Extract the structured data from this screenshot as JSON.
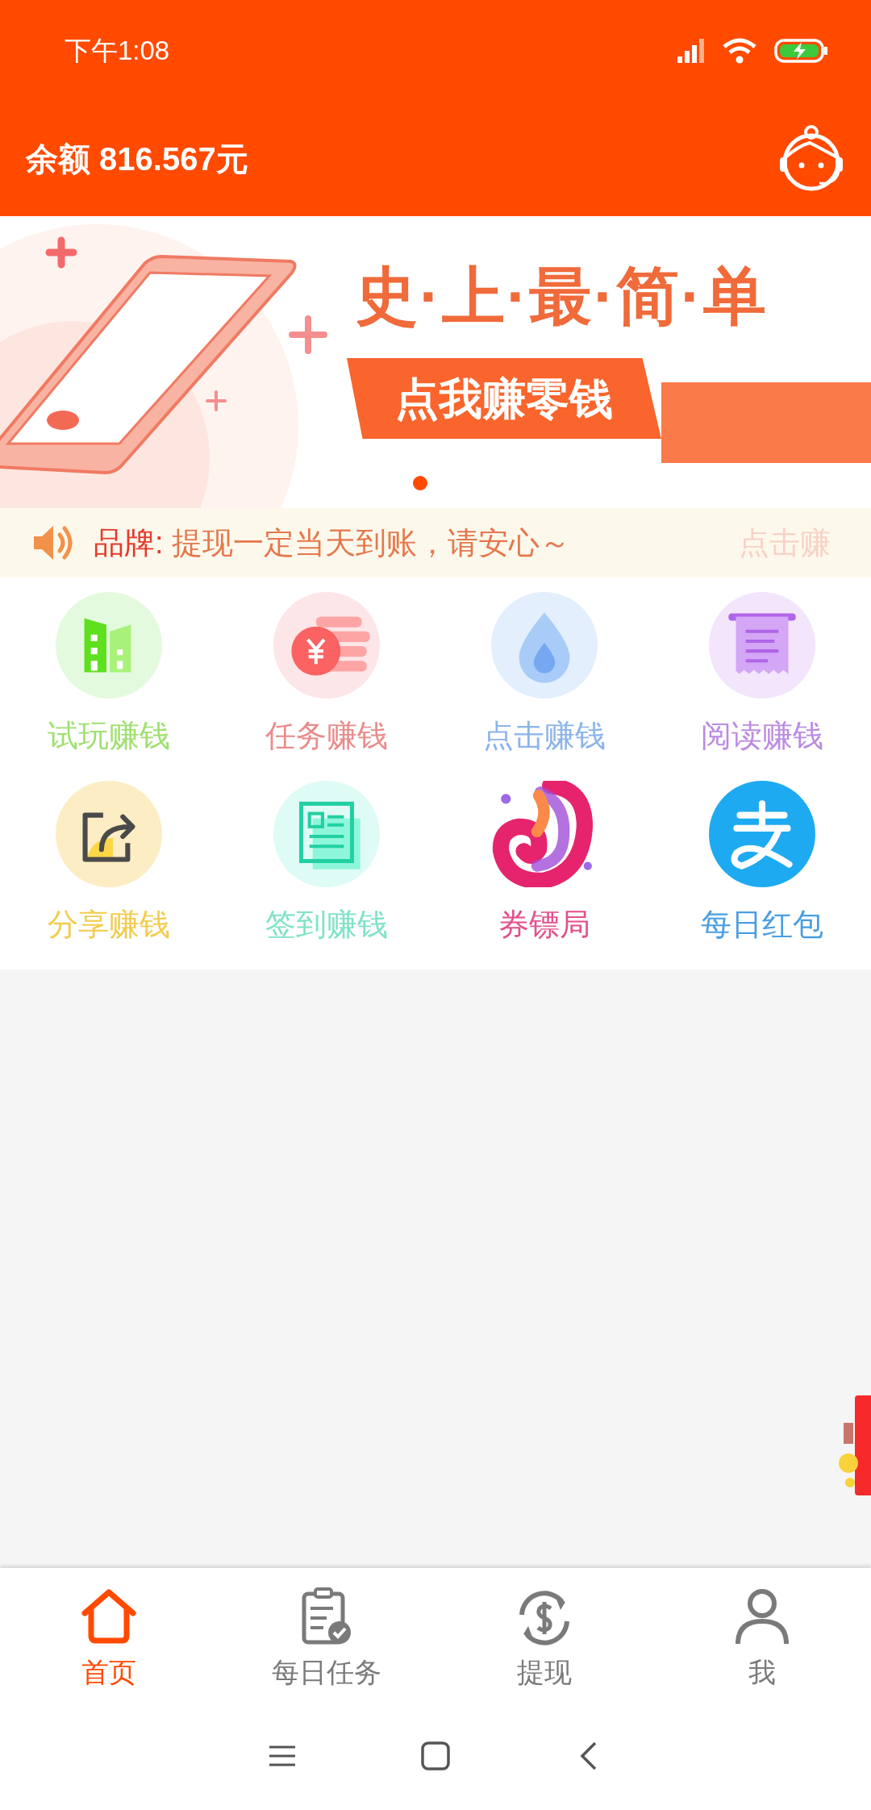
{
  "status_bar": {
    "time": "下午1:08"
  },
  "header": {
    "balance": "余额 816.567元"
  },
  "banner": {
    "headline": "史·上·最·简·单",
    "button_text": "点我赚零钱",
    "indicators": [
      {
        "selected": true
      }
    ]
  },
  "notice": {
    "label": "品牌:",
    "message": "提现一定当天到账，请安心～",
    "next_text": "点击赚"
  },
  "grid": [
    {
      "label": "试玩赚钱",
      "kind": "building",
      "color": "#9fe070"
    },
    {
      "label": "任务赚钱",
      "kind": "coins",
      "color": "#e98c8c"
    },
    {
      "label": "点击赚钱",
      "kind": "drop",
      "color": "#8cb4ea"
    },
    {
      "label": "阅读赚钱",
      "kind": "receipt",
      "color": "#bb8ce2"
    },
    {
      "label": "分享赚钱",
      "kind": "share",
      "color": "#f2cc4e"
    },
    {
      "label": "签到赚钱",
      "kind": "news",
      "color": "#80e2c8"
    },
    {
      "label": "券镖局",
      "kind": "logo",
      "color": "#e2508c"
    },
    {
      "label": "每日红包",
      "kind": "alipay",
      "color": "#4a9ee2"
    }
  ],
  "bottom_nav": [
    {
      "label": "首页",
      "kind": "home",
      "selected": true
    },
    {
      "label": "每日任务",
      "kind": "tasks",
      "selected": false
    },
    {
      "label": "提现",
      "kind": "cash",
      "selected": false
    },
    {
      "label": "我",
      "kind": "user",
      "selected": false
    }
  ]
}
